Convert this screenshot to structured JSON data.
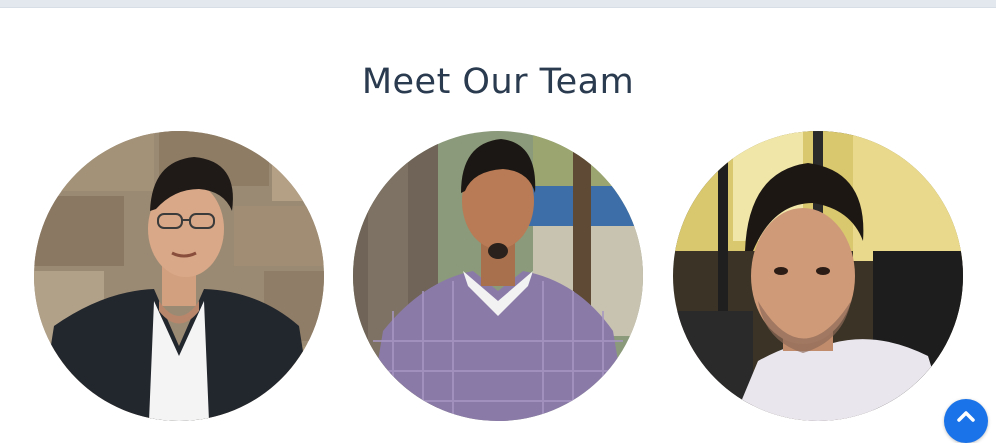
{
  "section": {
    "title": "Meet Our Team"
  },
  "team": [
    {
      "avatar_icon": "team-member-photo"
    },
    {
      "avatar_icon": "team-member-photo"
    },
    {
      "avatar_icon": "team-member-photo"
    }
  ],
  "scroll_top": {
    "icon": "chevron-up-icon",
    "color": "#1a73e8"
  }
}
